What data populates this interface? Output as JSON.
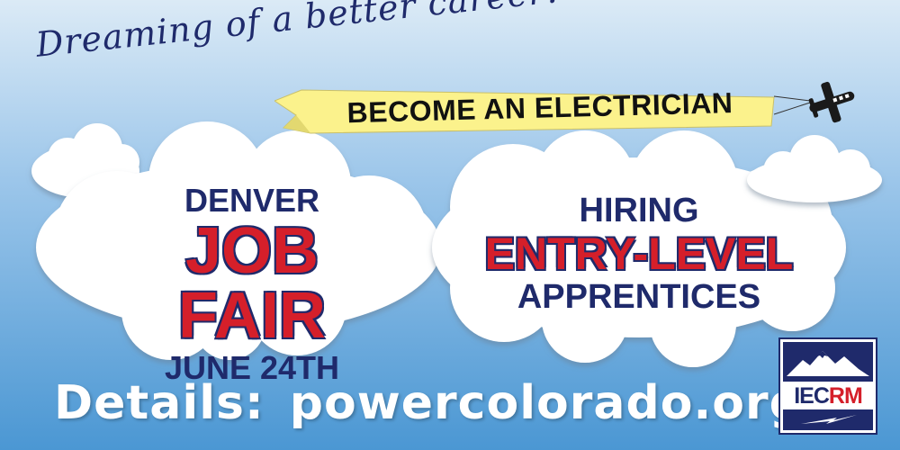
{
  "tagline": "Dreaming of a better career?",
  "streamer": {
    "text": "BECOME AN ELECTRICIAN",
    "color": "#fbf28c"
  },
  "left_cloud": {
    "line1": "DENVER",
    "line2": "JOB FAIR",
    "line3": "JUNE 24TH"
  },
  "right_cloud": {
    "line1": "HIRING",
    "line2": "ENTRY-LEVEL",
    "line3": "APPRENTICES"
  },
  "details": {
    "label": "Details:",
    "url": "powercolorado.org"
  },
  "logo": {
    "part1": "IEC",
    "part2": "RM"
  },
  "colors": {
    "navy": "#1f2a6b",
    "red": "#d51f2a",
    "sky_top": "#dbeaf6",
    "sky_bottom": "#4b97d3"
  },
  "icons": [
    "airplane-icon",
    "cloud-icon",
    "mountain-icon",
    "lightning-icon"
  ]
}
